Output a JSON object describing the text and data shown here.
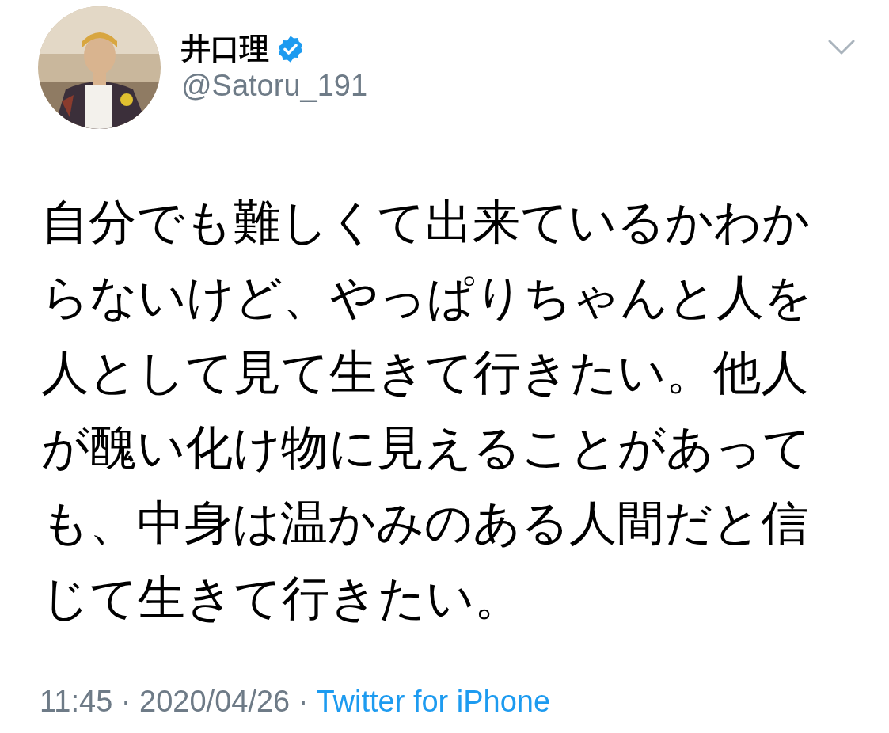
{
  "author": {
    "name": "井口理",
    "handle": "@Satoru_191",
    "verified": true
  },
  "tweet": {
    "text": "自分でも難しくて出来ているかわからないけど、やっぱりちゃんと人を人として見て生きて行きたい。他人が醜い化け物に見えることがあっても、中身は温かみのある人間だと信じて生きて行きたい。"
  },
  "meta": {
    "timestamp": "11:45 · 2020/04/26 ·",
    "source": "Twitter for iPhone"
  }
}
